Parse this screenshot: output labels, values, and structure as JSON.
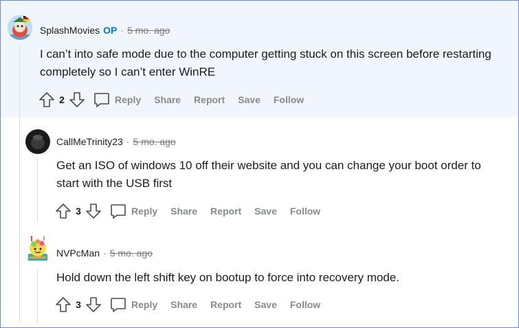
{
  "comments": [
    {
      "author": "SplashMovies",
      "op_badge": "OP",
      "separator": "·",
      "time": "5 mo. ago",
      "body": "I can’t into safe mode due to the computer getting stuck on this screen before restarting completely so I can’t enter WinRE",
      "votes": "2",
      "reply": "Reply",
      "share": "Share",
      "report": "Report",
      "save": "Save",
      "follow": "Follow"
    },
    {
      "author": "CallMeTrinity23",
      "separator": "·",
      "time": "5 mo. ago",
      "body": "Get an ISO of windows 10 off their website and you can change your boot order to start with the USB first",
      "votes": "3",
      "reply": "Reply",
      "share": "Share",
      "report": "Report",
      "save": "Save",
      "follow": "Follow"
    },
    {
      "author": "NVPcMan",
      "separator": "·",
      "time": "5 mo. ago",
      "body": "Hold down the left shift key on bootup to force into recovery mode.",
      "votes": "3",
      "reply": "Reply",
      "share": "Share",
      "report": "Report",
      "save": "Save",
      "follow": "Follow"
    }
  ],
  "colors": {
    "highlight": "#f1f5fc",
    "op": "#0079d3",
    "muted": "#878a8c",
    "border": "#6b88d6"
  }
}
